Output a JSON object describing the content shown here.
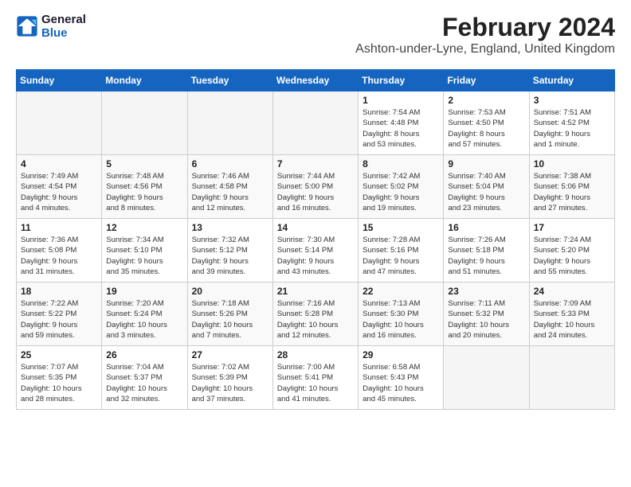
{
  "header": {
    "logo_line1": "General",
    "logo_line2": "Blue",
    "title": "February 2024",
    "subtitle": "Ashton-under-Lyne, England, United Kingdom"
  },
  "columns": [
    "Sunday",
    "Monday",
    "Tuesday",
    "Wednesday",
    "Thursday",
    "Friday",
    "Saturday"
  ],
  "weeks": [
    [
      {
        "day": "",
        "info": ""
      },
      {
        "day": "",
        "info": ""
      },
      {
        "day": "",
        "info": ""
      },
      {
        "day": "",
        "info": ""
      },
      {
        "day": "1",
        "info": "Sunrise: 7:54 AM\nSunset: 4:48 PM\nDaylight: 8 hours\nand 53 minutes."
      },
      {
        "day": "2",
        "info": "Sunrise: 7:53 AM\nSunset: 4:50 PM\nDaylight: 8 hours\nand 57 minutes."
      },
      {
        "day": "3",
        "info": "Sunrise: 7:51 AM\nSunset: 4:52 PM\nDaylight: 9 hours\nand 1 minute."
      }
    ],
    [
      {
        "day": "4",
        "info": "Sunrise: 7:49 AM\nSunset: 4:54 PM\nDaylight: 9 hours\nand 4 minutes."
      },
      {
        "day": "5",
        "info": "Sunrise: 7:48 AM\nSunset: 4:56 PM\nDaylight: 9 hours\nand 8 minutes."
      },
      {
        "day": "6",
        "info": "Sunrise: 7:46 AM\nSunset: 4:58 PM\nDaylight: 9 hours\nand 12 minutes."
      },
      {
        "day": "7",
        "info": "Sunrise: 7:44 AM\nSunset: 5:00 PM\nDaylight: 9 hours\nand 16 minutes."
      },
      {
        "day": "8",
        "info": "Sunrise: 7:42 AM\nSunset: 5:02 PM\nDaylight: 9 hours\nand 19 minutes."
      },
      {
        "day": "9",
        "info": "Sunrise: 7:40 AM\nSunset: 5:04 PM\nDaylight: 9 hours\nand 23 minutes."
      },
      {
        "day": "10",
        "info": "Sunrise: 7:38 AM\nSunset: 5:06 PM\nDaylight: 9 hours\nand 27 minutes."
      }
    ],
    [
      {
        "day": "11",
        "info": "Sunrise: 7:36 AM\nSunset: 5:08 PM\nDaylight: 9 hours\nand 31 minutes."
      },
      {
        "day": "12",
        "info": "Sunrise: 7:34 AM\nSunset: 5:10 PM\nDaylight: 9 hours\nand 35 minutes."
      },
      {
        "day": "13",
        "info": "Sunrise: 7:32 AM\nSunset: 5:12 PM\nDaylight: 9 hours\nand 39 minutes."
      },
      {
        "day": "14",
        "info": "Sunrise: 7:30 AM\nSunset: 5:14 PM\nDaylight: 9 hours\nand 43 minutes."
      },
      {
        "day": "15",
        "info": "Sunrise: 7:28 AM\nSunset: 5:16 PM\nDaylight: 9 hours\nand 47 minutes."
      },
      {
        "day": "16",
        "info": "Sunrise: 7:26 AM\nSunset: 5:18 PM\nDaylight: 9 hours\nand 51 minutes."
      },
      {
        "day": "17",
        "info": "Sunrise: 7:24 AM\nSunset: 5:20 PM\nDaylight: 9 hours\nand 55 minutes."
      }
    ],
    [
      {
        "day": "18",
        "info": "Sunrise: 7:22 AM\nSunset: 5:22 PM\nDaylight: 9 hours\nand 59 minutes."
      },
      {
        "day": "19",
        "info": "Sunrise: 7:20 AM\nSunset: 5:24 PM\nDaylight: 10 hours\nand 3 minutes."
      },
      {
        "day": "20",
        "info": "Sunrise: 7:18 AM\nSunset: 5:26 PM\nDaylight: 10 hours\nand 7 minutes."
      },
      {
        "day": "21",
        "info": "Sunrise: 7:16 AM\nSunset: 5:28 PM\nDaylight: 10 hours\nand 12 minutes."
      },
      {
        "day": "22",
        "info": "Sunrise: 7:13 AM\nSunset: 5:30 PM\nDaylight: 10 hours\nand 16 minutes."
      },
      {
        "day": "23",
        "info": "Sunrise: 7:11 AM\nSunset: 5:32 PM\nDaylight: 10 hours\nand 20 minutes."
      },
      {
        "day": "24",
        "info": "Sunrise: 7:09 AM\nSunset: 5:33 PM\nDaylight: 10 hours\nand 24 minutes."
      }
    ],
    [
      {
        "day": "25",
        "info": "Sunrise: 7:07 AM\nSunset: 5:35 PM\nDaylight: 10 hours\nand 28 minutes."
      },
      {
        "day": "26",
        "info": "Sunrise: 7:04 AM\nSunset: 5:37 PM\nDaylight: 10 hours\nand 32 minutes."
      },
      {
        "day": "27",
        "info": "Sunrise: 7:02 AM\nSunset: 5:39 PM\nDaylight: 10 hours\nand 37 minutes."
      },
      {
        "day": "28",
        "info": "Sunrise: 7:00 AM\nSunset: 5:41 PM\nDaylight: 10 hours\nand 41 minutes."
      },
      {
        "day": "29",
        "info": "Sunrise: 6:58 AM\nSunset: 5:43 PM\nDaylight: 10 hours\nand 45 minutes."
      },
      {
        "day": "",
        "info": ""
      },
      {
        "day": "",
        "info": ""
      }
    ]
  ]
}
